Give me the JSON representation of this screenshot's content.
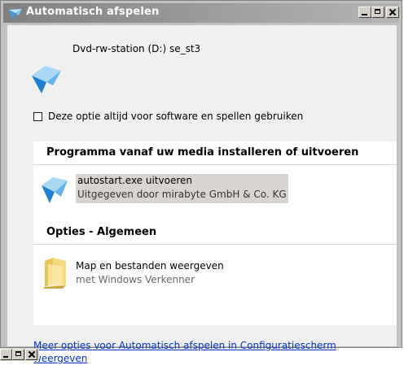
{
  "window": {
    "title": "Automatisch afspelen",
    "title_icon": "autoplay-icon",
    "controls": [
      "minimize-icon",
      "maximize-icon",
      "close-icon"
    ]
  },
  "device": {
    "label": "Dvd-rw-station (D:) se_st3",
    "icon": "dvd-drive-icon"
  },
  "always_option": {
    "label": "Deze optie altijd voor software en spellen gebruiken",
    "checked": false
  },
  "sections": [
    {
      "header": "Programma vanaf uw media installeren of uitvoeren",
      "option": {
        "title": "autostart.exe uitvoeren",
        "subtitle": "Uitgegeven door mirabyte GmbH & Co. KG",
        "icon": "autoplay-program-icon",
        "highlighted": true
      }
    },
    {
      "header": "Opties - Algemeen",
      "option": {
        "title": "Map en bestanden weergeven",
        "subtitle": "met Windows Verkenner",
        "icon": "folder-icon",
        "highlighted": false
      }
    }
  ],
  "config_link": "Meer opties voor Automatisch afspelen in Configuratiescherm weergeven",
  "colors": {
    "link": "#0033cc",
    "highlight": "#d9d4cf",
    "client_bg": "#f0f0f0"
  }
}
